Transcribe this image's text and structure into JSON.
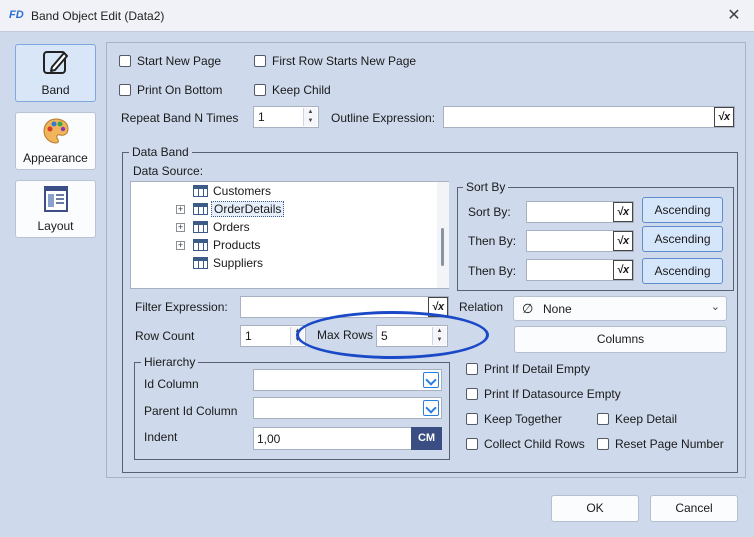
{
  "window": {
    "title": "Band Object Edit (Data2)",
    "app_icon": "FD",
    "close": "✕"
  },
  "sidebar": {
    "items": [
      {
        "label": "Band",
        "icon": "edit-pencil-icon",
        "active": true
      },
      {
        "label": "Appearance",
        "icon": "palette-icon",
        "active": false
      },
      {
        "label": "Layout",
        "icon": "layout-icon",
        "active": false
      }
    ]
  },
  "options": {
    "start_new_page": "Start New Page",
    "first_row_starts_new_page": "First Row Starts New Page",
    "print_on_bottom": "Print On Bottom",
    "keep_child": "Keep Child",
    "repeat_band_label": "Repeat Band N Times",
    "repeat_band_value": "1",
    "outline_label": "Outline Expression:",
    "outline_value": ""
  },
  "data_band": {
    "title": "Data Band",
    "data_source_label": "Data Source:",
    "tree": [
      {
        "label": "Customers",
        "expandable": false,
        "selected": false
      },
      {
        "label": "OrderDetails",
        "expandable": true,
        "selected": true
      },
      {
        "label": "Orders",
        "expandable": true,
        "selected": false
      },
      {
        "label": "Products",
        "expandable": true,
        "selected": false
      },
      {
        "label": "Suppliers",
        "expandable": false,
        "selected": false
      }
    ],
    "sort": {
      "title": "Sort By",
      "rows": [
        {
          "label": "Sort By:",
          "value": "",
          "order": "Ascending"
        },
        {
          "label": "Then By:",
          "value": "",
          "order": "Ascending"
        },
        {
          "label": "Then By:",
          "value": "",
          "order": "Ascending"
        }
      ]
    },
    "filter_label": "Filter Expression:",
    "filter_value": "",
    "relation_label": "Relation",
    "relation_value": "None",
    "relation_icon": "∅",
    "row_count_label": "Row Count",
    "row_count_value": "1",
    "max_rows_label": "Max Rows",
    "max_rows_value": "5",
    "columns_button": "Columns",
    "hierarchy": {
      "title": "Hierarchy",
      "id_column_label": "Id Column",
      "id_column_value": "",
      "parent_id_label": "Parent Id Column",
      "parent_id_value": "",
      "indent_label": "Indent",
      "indent_value": "1,00",
      "unit": "CM"
    },
    "checks": {
      "print_if_detail_empty": "Print If Detail Empty",
      "print_if_datasource_empty": "Print If Datasource Empty",
      "keep_together": "Keep Together",
      "keep_detail": "Keep Detail",
      "collect_child_rows": "Collect Child Rows",
      "reset_page_number": "Reset Page Number"
    }
  },
  "footer": {
    "ok": "OK",
    "cancel": "Cancel"
  },
  "fx_glyph": "√x",
  "colors": {
    "accent": "#2a7de1",
    "highlight_ellipse": "#1a49c7",
    "selected_button": "#d5e5fa"
  }
}
